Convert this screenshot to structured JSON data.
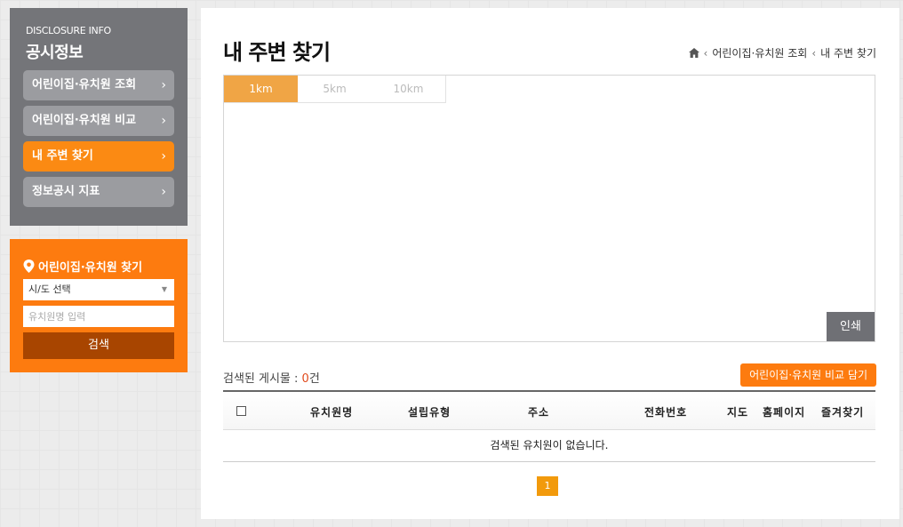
{
  "sidebar": {
    "subtitle": "DISCLOSURE INFO",
    "title": "공시정보",
    "items": [
      {
        "label": "어린이집·유치원 조회"
      },
      {
        "label": "어린이집·유치원 비교"
      },
      {
        "label": "내 주변 찾기"
      },
      {
        "label": "정보공시 지표"
      }
    ],
    "active_index": 2,
    "chevron": "›"
  },
  "search": {
    "title": "어린이집·유치원 찾기",
    "region_select": "시/도 선택",
    "name_placeholder": "유치원명 입력",
    "button_label": "검색",
    "icon": "map-pin-icon"
  },
  "main": {
    "page_title": "내 주변 찾기",
    "breadcrumb": [
      "어린이집·유치원 조회",
      "내 주변 찾기"
    ],
    "breadcrumb_sep": "‹",
    "tabs": [
      {
        "label": "1km"
      },
      {
        "label": "5km"
      },
      {
        "label": "10km"
      }
    ],
    "active_tab": 0,
    "print_label": "인쇄",
    "count_label": "검색된 게시물 : ",
    "count_value": "0",
    "count_unit": "건",
    "compare_label": "어린이집·유치원 비교 담기",
    "columns": [
      "유치원명",
      "설립유형",
      "주소",
      "전화번호",
      "지도",
      "홈페이지",
      "즐겨찾기"
    ],
    "empty_message": "검색된 유치원이 없습니다.",
    "pages": [
      "1"
    ]
  },
  "colors": {
    "accent": "#fd7b0f",
    "sidebar_bg": "#747579",
    "menu_active": "#fb8a13",
    "search_button": "#a84500",
    "tab_active": "#f0a545"
  }
}
